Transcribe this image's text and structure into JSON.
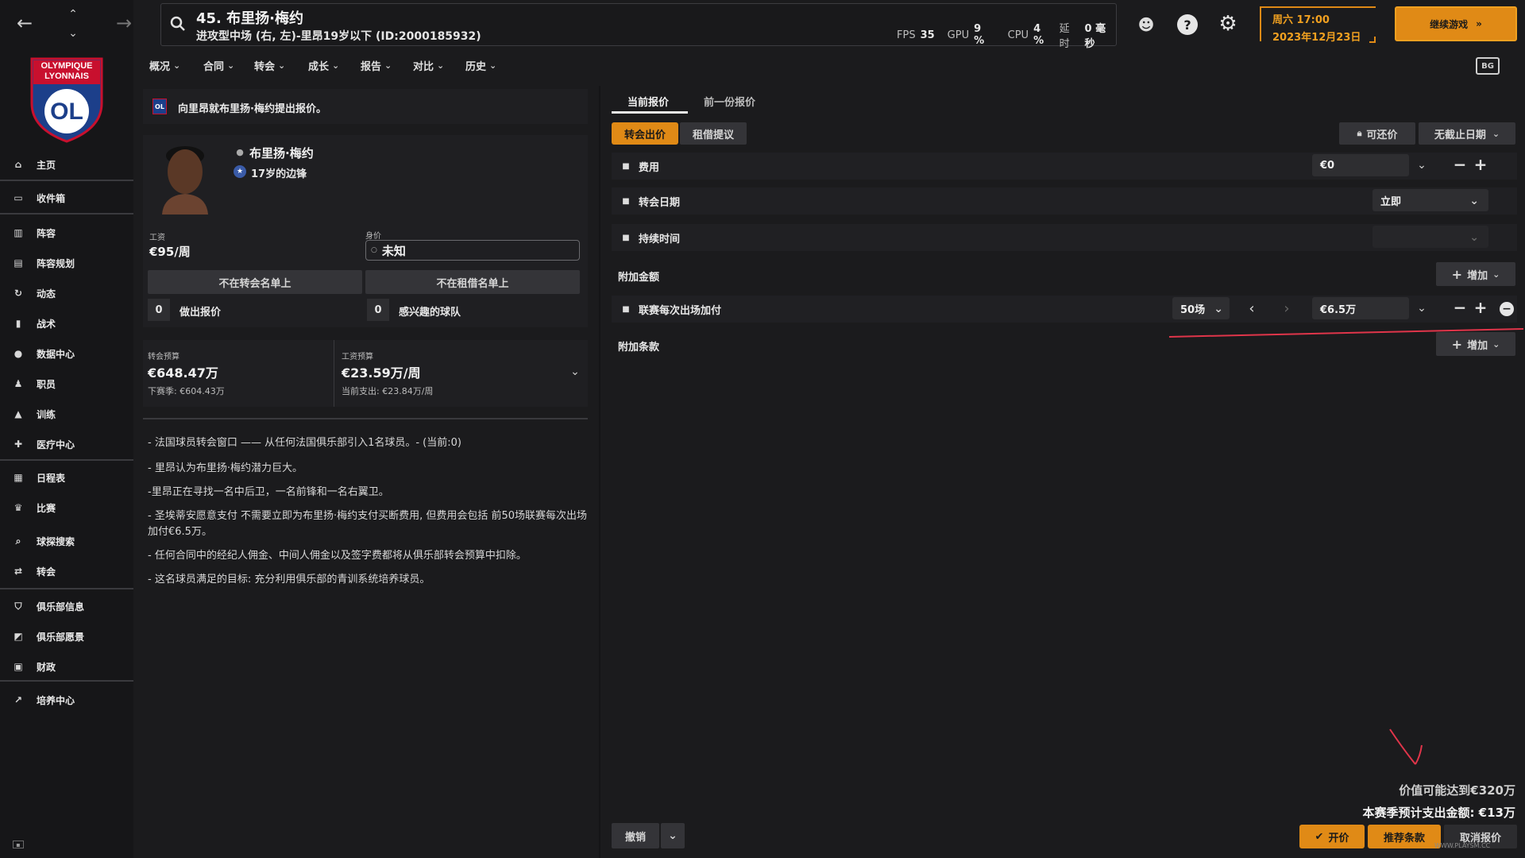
{
  "player": {
    "header_title": "45. 布里扬·梅约",
    "header_subtitle": "进攻型中场 (右, 左)-里昂19岁以下 (ID:2000185932)",
    "name": "布里扬·梅约",
    "age_position": "17岁的边锋",
    "wage_label": "工资",
    "wage": "€95/周",
    "value_label": "身价",
    "value": "未知"
  },
  "stats": {
    "fps_label": "FPS",
    "fps": "35",
    "gpu_label": "GPU",
    "gpu": "9 %",
    "cpu_label": "CPU",
    "cpu": "4 %",
    "latency_label": "延时",
    "latency": "0 毫秒"
  },
  "datetime": {
    "time": "周六 17:00",
    "date": "2023年12月23日"
  },
  "continue_label": "继续游戏",
  "club_logo": {
    "line1": "OLYMPIQUE",
    "line2": "LYONNAIS",
    "monogram": "OL"
  },
  "sidebar": [
    {
      "label": "主页",
      "icon": "home-icon"
    },
    {
      "label": "收件箱",
      "icon": "inbox-icon"
    },
    {
      "label": "阵容",
      "icon": "squad-icon"
    },
    {
      "label": "阵容规划",
      "icon": "clipboard-icon"
    },
    {
      "label": "动态",
      "icon": "dynamics-icon"
    },
    {
      "label": "战术",
      "icon": "tactics-icon"
    },
    {
      "label": "数据中心",
      "icon": "data-hub-icon"
    },
    {
      "label": "职员",
      "icon": "staff-icon"
    },
    {
      "label": "训练",
      "icon": "training-icon"
    },
    {
      "label": "医疗中心",
      "icon": "medical-icon"
    },
    {
      "label": "日程表",
      "icon": "calendar-icon"
    },
    {
      "label": "比赛",
      "icon": "trophy-icon"
    },
    {
      "label": "球探搜索",
      "icon": "scouting-icon"
    },
    {
      "label": "转会",
      "icon": "transfer-icon"
    },
    {
      "label": "俱乐部信息",
      "icon": "shield-icon"
    },
    {
      "label": "俱乐部愿景",
      "icon": "vision-icon"
    },
    {
      "label": "财政",
      "icon": "finance-icon"
    },
    {
      "label": "培养中心",
      "icon": "development-icon"
    }
  ],
  "menu": [
    "概况",
    "合同",
    "转会",
    "成长",
    "报告",
    "对比",
    "历史"
  ],
  "left_panel": {
    "offer_banner": "向里昂就布里扬·梅约提出报价。",
    "transfer_list": "不在转会名单上",
    "loan_list": "不在租借名单上",
    "offers_count": "0",
    "offers_label": "做出报价",
    "interested_count": "0",
    "interested_label": "感兴趣的球队",
    "budget_label": "转会预算",
    "budget": "€648.47万",
    "budget_next": "下赛季: €604.43万",
    "wage_budget_label": "工资预算",
    "wage_budget": "€23.59万/周",
    "wage_spend": "当前支出: €23.84万/周",
    "notes": [
      "- 法国球员转会窗口 —— 从任何法国俱乐部引入1名球员。- (当前:0)",
      "- 里昂认为布里扬·梅约潜力巨大。",
      "-里昂正在寻找一名中后卫，一名前锋和一名右翼卫。",
      "- 圣埃蒂安愿意支付 不需要立即为布里扬·梅约支付买断费用, 但费用会包括 前50场联赛每次出场加付€6.5万。",
      "- 任何合同中的经纪人佣金、中间人佣金以及签字费都将从俱乐部转会预算中扣除。",
      "- 这名球员满足的目标: 充分利用俱乐部的青训系统培养球员。"
    ]
  },
  "right_panel": {
    "tab_current": "当前报价",
    "tab_previous": "前一份报价",
    "subtab_transfer": "转会出价",
    "subtab_loan": "租借提议",
    "negotiable": "可还价",
    "deadline": "无截止日期",
    "fee_label": "费用",
    "fee_value": "€0",
    "date_label": "转会日期",
    "date_value": "立即",
    "duration_label": "持续时间",
    "duration_value": "",
    "addons_label": "附加金额",
    "add_label": "增加",
    "appearance_label": "联赛每次出场加付",
    "appearance_count": "50场",
    "appearance_value": "€6.5万",
    "clauses_label": "附加条款",
    "potential_value": "价值可能达到€320万",
    "season_spend": "本赛季预计支出金额: €13万",
    "undo": "撤销",
    "offer": "开价",
    "suggest": "推荐条款",
    "cancel": "取消报价",
    "watermark": "WWW.PLAYSM.CC"
  }
}
